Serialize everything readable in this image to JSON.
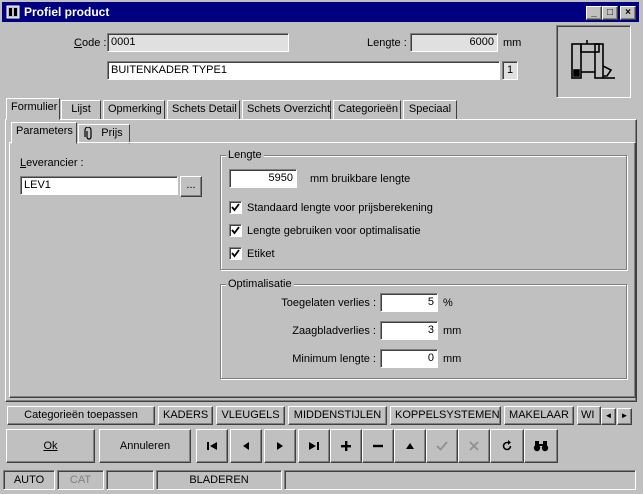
{
  "window": {
    "title": "Profiel product",
    "minimize": "_",
    "maximize": "□",
    "close": "×"
  },
  "header": {
    "code_label": "Code :",
    "code_value": "0001",
    "length_label": "Lengte :",
    "length_value": "6000",
    "length_unit": "mm",
    "description": "BUITENKADER TYPE1",
    "description_index": "1"
  },
  "main_tabs": [
    {
      "label": "Formulier"
    },
    {
      "label": "Lijst"
    },
    {
      "label": "Opmerking"
    },
    {
      "label": "Schets Detail"
    },
    {
      "label": "Schets Overzicht"
    },
    {
      "label": "Categorieën"
    },
    {
      "label": "Speciaal"
    }
  ],
  "sub_tabs": [
    {
      "label": "Parameters"
    },
    {
      "label": "Prijs"
    }
  ],
  "supplier": {
    "label": "Leverancier :",
    "value": "LEV1",
    "browse": "..."
  },
  "length_group": {
    "title": "Lengte",
    "usable_value": "5950",
    "usable_unit": "mm bruikbare lengte",
    "options": [
      {
        "label": "Standaard lengte voor prijsberekening",
        "checked": true
      },
      {
        "label": "Lengte gebruiken voor optimalisatie",
        "checked": true
      },
      {
        "label": "Etiket",
        "checked": true
      }
    ]
  },
  "optimization_group": {
    "title": "Optimalisatie",
    "rows": [
      {
        "label": "Toegelaten verlies :",
        "value": "5",
        "unit": "%"
      },
      {
        "label": "Zaagbladverlies :",
        "value": "3",
        "unit": "mm"
      },
      {
        "label": "Minimum lengte :",
        "value": "0",
        "unit": "mm"
      }
    ]
  },
  "category_strip": {
    "apply": "Categorieën toepassen",
    "tabs": [
      "KADERS",
      "VLEUGELS",
      "MIDDENSTIJLEN",
      "KOPPELSYSTEMEN",
      "MAKELAAR",
      "WI"
    ],
    "scroll_left": "◄",
    "scroll_right": "►"
  },
  "buttons": {
    "ok": "Ok",
    "cancel": "Annuleren"
  },
  "nav_icons": [
    "first-record-icon",
    "prev-record-icon",
    "next-record-icon",
    "last-record-icon",
    "add-record-icon",
    "delete-record-icon",
    "edit-record-icon",
    "confirm-icon",
    "cancel-edit-icon",
    "refresh-icon",
    "search-binoculars-icon"
  ],
  "status": {
    "mode1": "AUTO",
    "mode2": "CAT",
    "state": "BLADEREN"
  }
}
